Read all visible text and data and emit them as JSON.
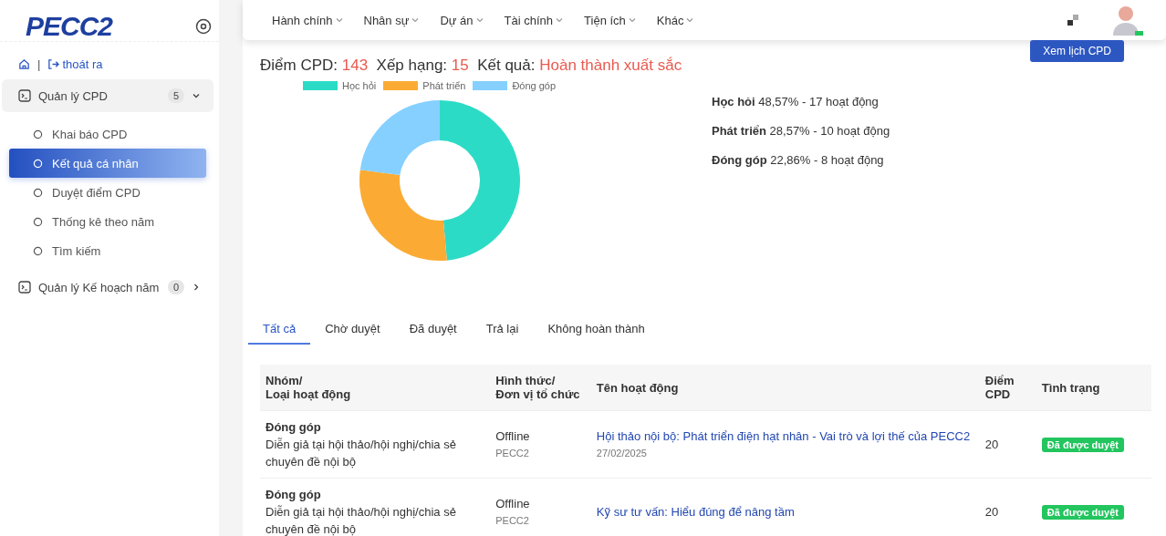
{
  "sidebar": {
    "logo": "PECC2",
    "home_separator": "|",
    "logout": "thoát ra",
    "menu": [
      {
        "label": "Quản lý CPD",
        "count": "5",
        "expanded": true,
        "children": [
          {
            "label": "Khai báo CPD",
            "selected": false
          },
          {
            "label": "Kết quả cá nhân",
            "selected": true
          },
          {
            "label": "Duyệt điểm CPD",
            "selected": false
          },
          {
            "label": "Thống kê theo năm",
            "selected": false
          },
          {
            "label": "Tìm kiếm",
            "selected": false
          }
        ]
      },
      {
        "label": "Quản lý Kế hoạch năm",
        "count": "0",
        "expanded": false
      }
    ]
  },
  "topnav": [
    "Hành chính",
    "Nhân sự",
    "Dự án",
    "Tài chính",
    "Tiện ích",
    "Khác"
  ],
  "summary": {
    "score_label": "Điểm CPD:",
    "score": "143",
    "rank_label": "Xếp hạng:",
    "rank": "15",
    "result_label": "Kết quả:",
    "result": "Hoàn thành xuất sắc"
  },
  "calendar_button": "Xem lịch CPD",
  "chart": {
    "chart_data": {
      "type": "donut",
      "categories": [
        "Học hỏi",
        "Phát triển",
        "Đóng góp"
      ],
      "values": [
        48.57,
        28.57,
        22.86
      ],
      "colors": [
        "#2cdbc6",
        "#fbab34",
        "#85d0ff"
      ],
      "legend": true
    }
  },
  "breakdown": [
    {
      "name": "Học hỏi",
      "text": "48,57% - 17 hoạt động"
    },
    {
      "name": "Phát triển",
      "text": "28,57% - 10 hoạt động"
    },
    {
      "name": "Đóng góp",
      "text": "22,86% - 8 hoạt động"
    }
  ],
  "tabs": [
    {
      "label": "Tất cả",
      "selected": true
    },
    {
      "label": "Chờ duyệt",
      "selected": false
    },
    {
      "label": "Đã duyệt",
      "selected": false
    },
    {
      "label": "Trả lại",
      "selected": false
    },
    {
      "label": "Không hoàn thành",
      "selected": false
    }
  ],
  "table": {
    "columns": [
      "Nhóm/\nLoại hoạt động",
      "Hình thức/\nĐơn vị tổ chức",
      "Tên hoạt động",
      "Điểm\nCPD",
      "Tình trạng"
    ],
    "rows": [
      {
        "group": "Đóng góp",
        "type": "Diễn giả tại hội thảo/hội nghị/chia sẻ chuyên đề nội bộ",
        "format": "Offline",
        "unit": "PECC2",
        "name": "Hội thảo nội bộ: Phát triển điện hạt nhân - Vai trò và lợi thế của PECC2",
        "date": "27/02/2025",
        "points": "20",
        "status": "Đã được duyệt"
      },
      {
        "group": "Đóng góp",
        "type": "Diễn giả tại hội thảo/hội nghị/chia sẻ chuyên đề nội bộ",
        "format": "Offline",
        "unit": "PECC2",
        "name": "Kỹ sư tư vấn: Hiểu đúng để nâng tầm",
        "points": "20",
        "status": "Đã được duyệt"
      }
    ]
  }
}
